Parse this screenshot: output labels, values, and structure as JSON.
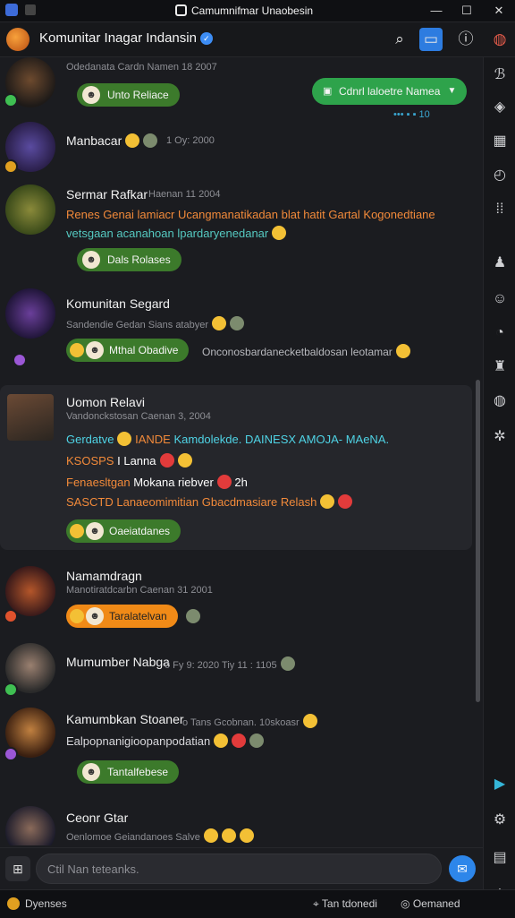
{
  "window": {
    "title": "Camumnifmar Unaobesin"
  },
  "header": {
    "title": "Komunitar Inagar Indansin"
  },
  "top_action": {
    "label": "Cdnrl laloetre Namea"
  },
  "top_meta": "••• ▪ ▪ 10",
  "messages": [
    {
      "meta": "Odedanata Cardn Namen 18 2007",
      "pill": "Unto Reliace"
    },
    {
      "name": "Manbacar",
      "meta": "1 Oy: 2000"
    },
    {
      "name": "Sermar Rafkar",
      "meta": "Haenan 11 2004",
      "line1": "Renes Genai lamiacr Ucangmanatikadan blat hatit Gartal Kogonedtiane",
      "line2": "vetsgaan acanahoan lpardaryenedanar",
      "pill": "Dals Rolases"
    },
    {
      "name": "Komunitan Segard",
      "meta": "Sandendie Gedan Sians atabyer",
      "pill": "Mthal Obadive",
      "pilltext": "Onconosbardanecketbaldosan leotamar"
    },
    {
      "name": "Uomon Relavi",
      "meta": "Vandonckstosan Caenan 3, 2004",
      "r1a": "Gerdatve",
      "r1b": "IANDE",
      "r1c": "Kamdolekde.",
      "r1d": "DAINESX",
      "r1e": "AMOJA- MAeNA.",
      "r2a": "KSOSPS",
      "r2b": "I",
      "r2c": "Lanna",
      "r3a": "Fenaesltgan",
      "r3b": "Mokana riebver",
      "r3c": "2h",
      "r4a": "SASCTD",
      "r4b": "Lanaeomimitian Gbacdmasiare Relash",
      "pill": "Oaeiatdanes"
    },
    {
      "name": "Namamdragn",
      "meta": "Manotiratdcarbn Caenan 31 2001",
      "pill": "Taralatelvan"
    },
    {
      "name": "Mumumber Nabga",
      "meta": "0 Fy 9: 2020 Tiy 11 : 1105"
    },
    {
      "name": "Kamumbkan Stoaner",
      "meta": "o Tans Gcobnan. 10skoasr",
      "line1": "Ealpopnanigioopanpodatian",
      "pill": "Tantalfebese"
    },
    {
      "name": "Ceonr Gtar",
      "meta": "Oenlomoe Geiandanoes Salve"
    }
  ],
  "composer": {
    "placeholder": "Ctil Nan teteanks."
  },
  "status": {
    "left": "Dyenses",
    "right1": "Tan tdonedi",
    "right2": "Oemaned"
  },
  "icons": {
    "header": [
      "search-icon",
      "card-icon",
      "info-icon",
      "globe-icon"
    ],
    "rail": [
      "link-icon",
      "tag-icon",
      "qr-icon",
      "clock-icon",
      "grid-icon",
      "users-icon",
      "smile-icon",
      "chat-icon",
      "bell-icon",
      "shield-icon",
      "gear-icon",
      "play-icon",
      "settings-icon",
      "list-icon",
      "power-icon"
    ]
  },
  "colors": {
    "accent": "#2d7ce0",
    "pill_green": "#3c7a2b",
    "pill_orange": "#f08a17",
    "cyan_text": "#4fd3e5",
    "orange_text": "#f28a3a"
  }
}
